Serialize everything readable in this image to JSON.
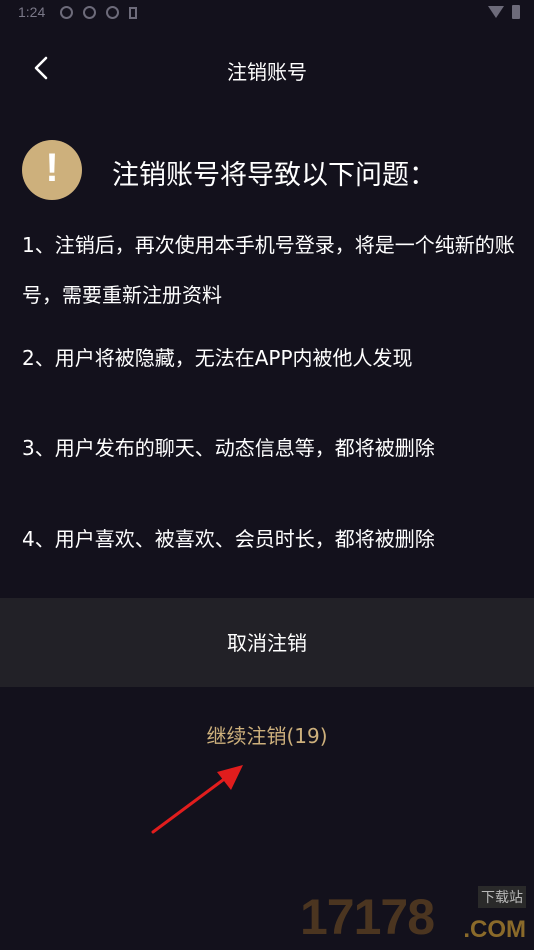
{
  "status_bar": {
    "time": "1:24"
  },
  "header": {
    "title": "注销账号",
    "back_icon": "chevron-left-icon"
  },
  "warning": {
    "icon_glyph": "!",
    "icon_color": "#cdb07c",
    "heading": "注销账号将导致以下问题："
  },
  "notices": [
    "1、注销后，再次使用本手机号登录，将是一个纯新的账号，需要重新注册资料",
    "2、用户将被隐藏，无法在APP内被他人发现",
    "3、用户发布的聊天、动态信息等，都将被删除",
    "4、用户喜欢、被喜欢、会员时长，都将被删除"
  ],
  "actions": {
    "cancel_label": "取消注销",
    "continue_label": "继续注销(19)",
    "accent_color": "#cdb07c"
  },
  "watermark": {
    "number": "17178",
    "dotcom": ".COM",
    "tag": "下载站"
  },
  "colors": {
    "background": "#13111c",
    "cancel_background": "#222127",
    "annotation_arrow": "#e11d1d"
  }
}
